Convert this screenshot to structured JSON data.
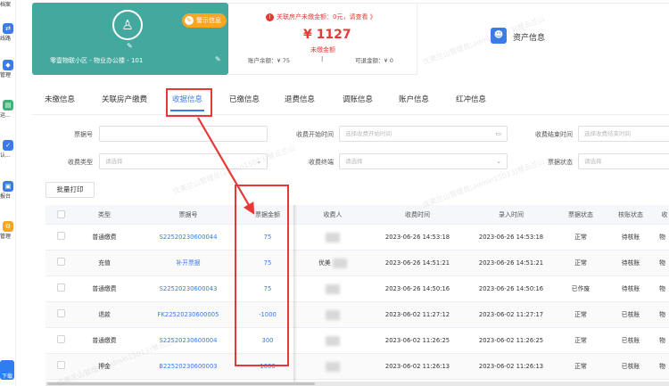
{
  "sidebar": {
    "items": [
      {
        "label": "档案",
        "icon": "archive-icon",
        "color": "#ffffff"
      },
      {
        "label": "线路",
        "icon": "route-icon",
        "color": "#3b7be8"
      },
      {
        "label": "管理",
        "icon": "manage-icon",
        "color": "#3b7be8"
      },
      {
        "label": "运...",
        "icon": "operation-icon",
        "color": "#3ab57a"
      },
      {
        "label": "认...",
        "icon": "certify-icon",
        "color": "#3b7be8"
      },
      {
        "label": "报台",
        "icon": "report-icon",
        "color": "#3b7be8"
      },
      {
        "label": "管理",
        "icon": "settings-icon",
        "color": "#f5a623"
      }
    ],
    "footer_label": "下载"
  },
  "card": {
    "address": "零壹物联小区 - 物业办公楼 - 101",
    "warn_tag": "警示信息"
  },
  "arrears": {
    "alert": "关联房产未缴金额：0元，请查看 》",
    "amount": "¥ 1127",
    "label": "未缴金额",
    "balance": "账户余额：¥ 75",
    "separator": "|",
    "refundable": "可退金额：¥ 0"
  },
  "asset": {
    "label": "资产信息"
  },
  "tabs": [
    {
      "label": "未缴信息"
    },
    {
      "label": "关联房产缴费"
    },
    {
      "label": "收据信息"
    },
    {
      "label": "已缴信息"
    },
    {
      "label": "退费信息"
    },
    {
      "label": "调账信息"
    },
    {
      "label": "账户信息"
    },
    {
      "label": "红冲信息"
    }
  ],
  "filters": {
    "receipt_no": {
      "label": "票据号",
      "placeholder": ""
    },
    "start_time": {
      "label": "收费开始时间",
      "placeholder": "选择收费开始时间"
    },
    "end_time": {
      "label": "收费结束时间",
      "placeholder": "选择收费结束时间"
    },
    "fee_type": {
      "label": "收费类型",
      "placeholder": "请选择"
    },
    "terminal": {
      "label": "收费终端",
      "placeholder": "请选择"
    },
    "receipt_status": {
      "label": "票据状态",
      "placeholder": "请选择"
    }
  },
  "batch_print_label": "批量打印",
  "table": {
    "headers": [
      "类型",
      "票据号",
      "票据金额",
      "收费人",
      "收费时间",
      "录入时间",
      "票据状态",
      "核账状态",
      "收"
    ],
    "rows": [
      {
        "type": "普通缴费",
        "receipt_no": "S22520230600044",
        "amount": "75",
        "payer": "",
        "charge_time": "2023-06-26 14:53:18",
        "entry_time": "2023-06-26 14:53:18",
        "status": "正常",
        "audit": "待核账",
        "extra": "物"
      },
      {
        "type": "充值",
        "receipt_no": "补开票据",
        "amount": "75",
        "payer": "优美",
        "charge_time": "2023-06-26 14:51:21",
        "entry_time": "2023-06-26 14:51:21",
        "status": "正常",
        "audit": "待核账",
        "extra": "物"
      },
      {
        "type": "普通缴费",
        "receipt_no": "S22520230600043",
        "amount": "75",
        "payer": "",
        "charge_time": "2023-06-26 14:50:16",
        "entry_time": "2023-06-26 14:50:16",
        "status": "已作废",
        "audit": "待核账",
        "extra": "物"
      },
      {
        "type": "退款",
        "receipt_no": "FK22520230600005",
        "amount": "-1000",
        "payer": "",
        "charge_time": "2023-06-02 11:27:12",
        "entry_time": "2023-06-02 11:27:17",
        "status": "正常",
        "audit": "已核账",
        "extra": "物"
      },
      {
        "type": "普通缴费",
        "receipt_no": "S22520230600004",
        "amount": "300",
        "payer": "",
        "charge_time": "2023-06-02 11:26:25",
        "entry_time": "2023-06-02 11:26:25",
        "status": "正常",
        "audit": "已核账",
        "extra": "物"
      },
      {
        "type": "押金",
        "receipt_no": "B22520230600003",
        "amount": "1000",
        "payer": "",
        "charge_time": "2023-06-02 11:26:13",
        "entry_time": "2023-06-02 11:26:13",
        "status": "正常",
        "audit": "已核账",
        "extra": "物"
      }
    ]
  },
  "watermark": "优美兰山管理员(admin15013)慧云兰山",
  "colors": {
    "accent": "#3b7be8",
    "card": "#43a89d",
    "danger": "#e53935",
    "warn": "#f5a623"
  }
}
